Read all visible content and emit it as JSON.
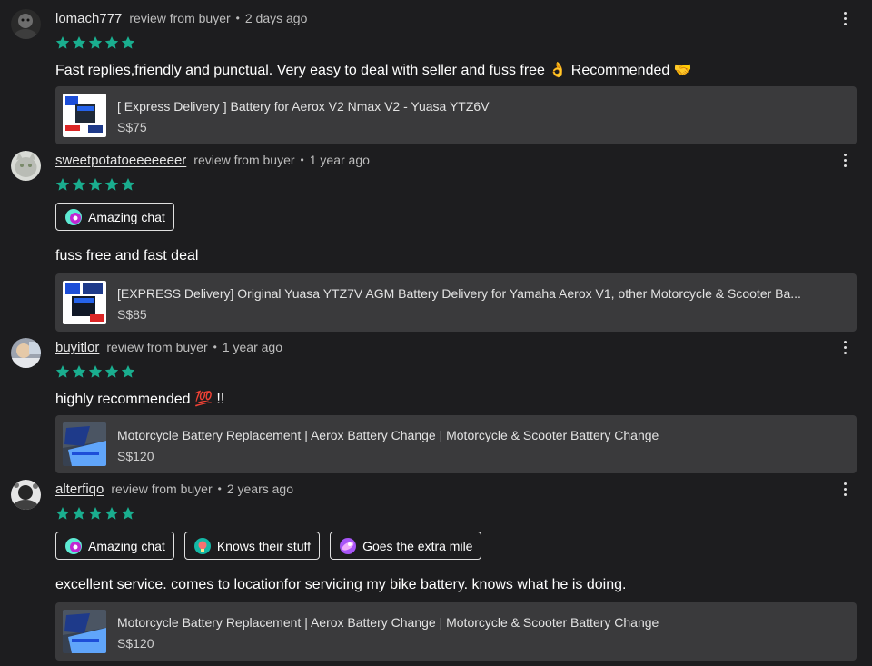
{
  "reviews": [
    {
      "username": "lomach777",
      "role": "review from buyer",
      "time": "2 days ago",
      "rating": 5,
      "text": "Fast replies,friendly and punctual. Very easy to deal with seller and fuss free 👌 Recommended 🤝",
      "tags": [],
      "product": {
        "name": "[ Express Delivery ] Battery for Aerox V2 Nmax V2 - Yuasa YTZ6V",
        "price": "S$75"
      }
    },
    {
      "username": "sweetpotatoeeeeeeer",
      "role": "review from buyer",
      "time": "1 year ago",
      "rating": 5,
      "text": "fuss free and fast deal",
      "tags": [
        "Amazing chat"
      ],
      "product": {
        "name": "[EXPRESS Delivery] Original Yuasa YTZ7V AGM Battery Delivery for Yamaha Aerox V1, other Motorcycle & Scooter Ba...",
        "price": "S$85"
      }
    },
    {
      "username": "buyitlor",
      "role": "review from buyer",
      "time": "1 year ago",
      "rating": 5,
      "text": "highly recommended 💯 !!",
      "tags": [],
      "product": {
        "name": "Motorcycle Battery Replacement | Aerox Battery Change | Motorcycle & Scooter Battery Change",
        "price": "S$120"
      }
    },
    {
      "username": "alterfiqo",
      "role": "review from buyer",
      "time": "2 years ago",
      "rating": 5,
      "text": "excellent service. comes to locationfor servicing my bike battery. knows what he is doing.",
      "tags": [
        "Amazing chat",
        "Knows their stuff",
        "Goes the extra mile"
      ],
      "product": {
        "name": "Motorcycle Battery Replacement | Aerox Battery Change | Motorcycle & Scooter Battery Change",
        "price": "S$120"
      }
    }
  ],
  "separator": "•",
  "colors": {
    "background": "#1d1d1f",
    "card": "#3a3a3c",
    "star": "#1aae8f"
  },
  "icons": {
    "menu": "more-vertical-icon",
    "star": "star-icon"
  }
}
